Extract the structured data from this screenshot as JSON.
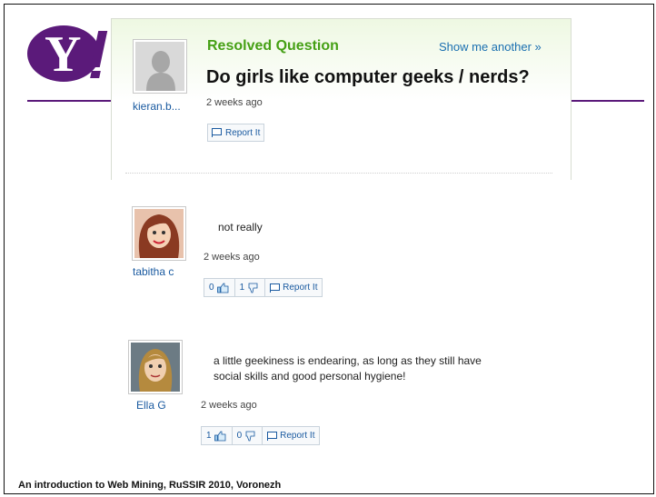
{
  "brand": {
    "logo_letter": "Y",
    "color": "#5b1a7a"
  },
  "question": {
    "status": "Resolved Question",
    "show_another": "Show me another »",
    "title": "Do girls like computer geeks / nerds?",
    "asker": "kieran.b...",
    "time": "2 weeks ago",
    "report_label": "Report It"
  },
  "answers": [
    {
      "user": "tabitha c",
      "text": "not really",
      "time": "2 weeks ago",
      "thumbs_up": "0",
      "thumbs_down": "1",
      "report_label": "Report It"
    },
    {
      "user": "Ella G",
      "text_line1": "a little geekiness is endearing, as long as they still have",
      "text_line2": "social skills and good personal hygiene!",
      "time": "2 weeks ago",
      "thumbs_up": "1",
      "thumbs_down": "0",
      "report_label": "Report It"
    }
  ],
  "footer": "An introduction to Web Mining, RuSSIR 2010, Voronezh",
  "colors": {
    "resolved": "#45a015",
    "link": "#1a6fb0",
    "title": "#111111"
  }
}
